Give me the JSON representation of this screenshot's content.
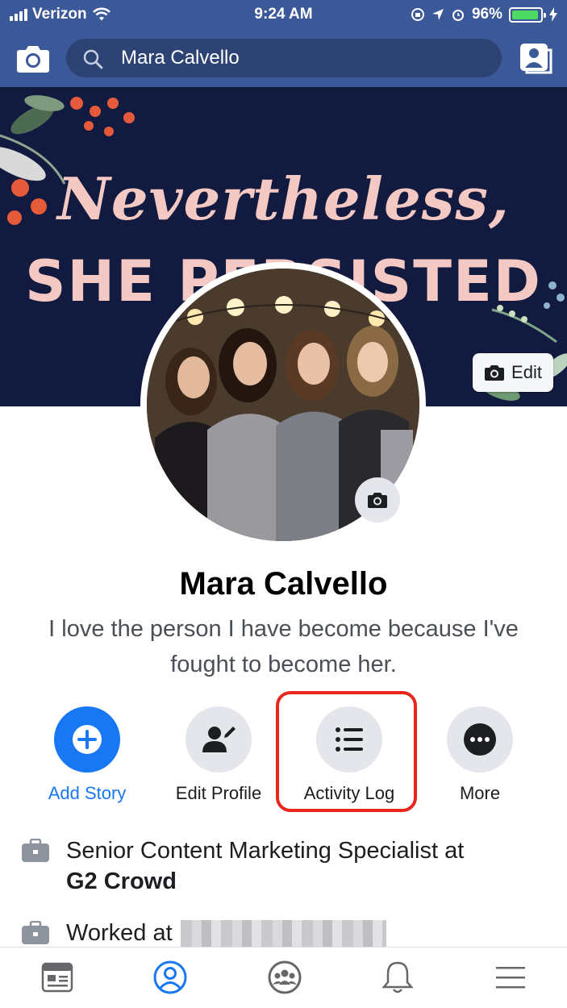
{
  "status_bar": {
    "carrier": "Verizon",
    "time": "9:24 AM",
    "battery_percent": "96%",
    "battery_level": 0.96
  },
  "nav": {
    "search_value": "Mara Calvello",
    "camera_icon": "camera-icon",
    "profile_icon": "profile-switch-icon",
    "accent_color": "#3b5998"
  },
  "cover": {
    "text_line1": "Nevertheless,",
    "text_line2": "SHE PERSISTED",
    "edit_label": "Edit"
  },
  "profile": {
    "name": "Mara Calvello",
    "bio": "I love the person I have become because I've fought to become her."
  },
  "actions": [
    {
      "label": "Add Story",
      "icon": "plus-icon"
    },
    {
      "label": "Edit Profile",
      "icon": "edit-profile-icon"
    },
    {
      "label": "Activity Log",
      "icon": "list-icon"
    },
    {
      "label": "More",
      "icon": "more-dots-icon"
    }
  ],
  "intro": {
    "work_current_prefix": "Senior Content Marketing Specialist at",
    "work_current_company": "G2 Crowd",
    "work_past_prefix": "Worked at"
  },
  "tabs": [
    {
      "name": "news-feed",
      "icon": "news-feed-icon"
    },
    {
      "name": "profile",
      "icon": "profile-icon",
      "active": true
    },
    {
      "name": "groups",
      "icon": "groups-icon"
    },
    {
      "name": "notifications",
      "icon": "bell-icon"
    },
    {
      "name": "menu",
      "icon": "menu-icon"
    }
  ],
  "colors": {
    "nav_blue": "#3b5998",
    "primary_blue": "#1877f2",
    "highlight_red": "#e8261c"
  }
}
